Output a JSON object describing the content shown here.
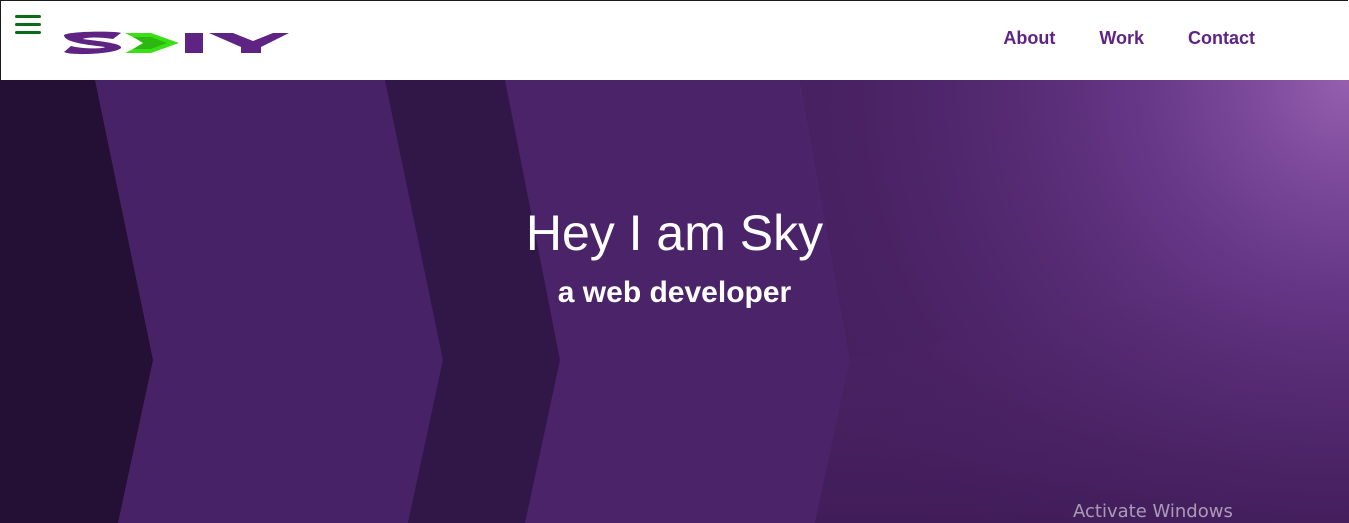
{
  "header": {
    "menu_icon": "hamburger-menu-icon",
    "logo_text": "SKY",
    "nav_links": [
      {
        "label": "About"
      },
      {
        "label": "Work"
      },
      {
        "label": "Contact"
      }
    ]
  },
  "hero": {
    "title": "Hey I am Sky",
    "subtitle": "a web developer"
  },
  "os_overlay": {
    "watermark": "Activate Windows"
  },
  "colors": {
    "brand_purple": "#5f2384",
    "menu_green": "#0a6b18",
    "logo_green": "#39e016",
    "hero_dark": "#2a1140",
    "hero_mid": "#4a2068",
    "hero_light": "#8e5aa8"
  }
}
